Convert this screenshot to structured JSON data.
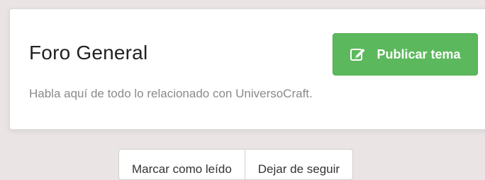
{
  "forum": {
    "title": "Foro General",
    "description": "Habla aquí de todo lo relacionado con UniversoCraft.",
    "publish_label": "Publicar tema",
    "publish_icon": "pencil-square-icon"
  },
  "actions": {
    "mark_read_label": "Marcar como leído",
    "unfollow_label": "Dejar de seguir"
  },
  "colors": {
    "success_green": "#5cb85c",
    "background": "#ebe4e4"
  }
}
